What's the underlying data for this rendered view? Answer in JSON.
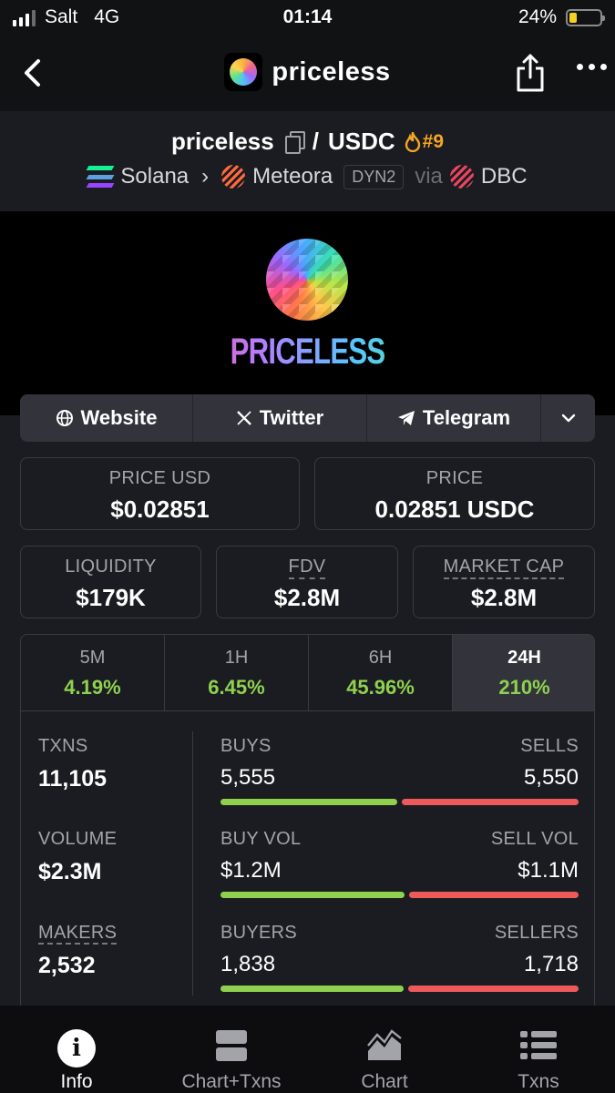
{
  "status_bar": {
    "carrier": "Salt",
    "network": "4G",
    "time": "01:14",
    "battery": "24%",
    "battery_level": 0.24
  },
  "nav": {
    "title": "priceless"
  },
  "pair": {
    "base": "priceless",
    "separator": "/",
    "quote": "USDC",
    "rank": "#9",
    "chain": "Solana",
    "dex": "Meteora",
    "pool_type": "DYN2",
    "via": "via",
    "launchpad": "DBC"
  },
  "banner": {
    "wordmark": "PRICELESS"
  },
  "links": {
    "website": "Website",
    "twitter": "Twitter",
    "telegram": "Telegram"
  },
  "price_usd": {
    "label": "PRICE USD",
    "value": "$0.02851"
  },
  "price": {
    "label": "PRICE",
    "value": "0.02851 USDC"
  },
  "liquidity": {
    "label": "LIQUIDITY",
    "value": "$179K"
  },
  "fdv": {
    "label": "FDV",
    "value": "$2.8M"
  },
  "market_cap": {
    "label": "MARKET CAP",
    "value": "$2.8M"
  },
  "timeframes": [
    {
      "name": "5M",
      "change": "4.19%"
    },
    {
      "name": "1H",
      "change": "6.45%"
    },
    {
      "name": "6H",
      "change": "45.96%"
    },
    {
      "name": "24H",
      "change": "210%"
    }
  ],
  "stats": {
    "txns": {
      "label": "TXNS",
      "value": "11,105"
    },
    "volume": {
      "label": "VOLUME",
      "value": "$2.3M"
    },
    "makers": {
      "label": "MAKERS",
      "value": "2,532"
    },
    "buys": {
      "label": "BUYS",
      "value": "5,555",
      "ratio": 0.5002
    },
    "sells": {
      "label": "SELLS",
      "value": "5,550"
    },
    "buy_vol": {
      "label": "BUY VOL",
      "value": "$1.2M",
      "ratio": 0.5217
    },
    "sell_vol": {
      "label": "SELL VOL",
      "value": "$1.1M"
    },
    "buyers": {
      "label": "BUYERS",
      "value": "1,838",
      "ratio": 0.5169
    },
    "sellers": {
      "label": "SELLERS",
      "value": "1,718"
    }
  },
  "colors": {
    "positive": "#8fd14f",
    "negative": "#ee5a5a",
    "rank": "#f5a623"
  },
  "bottom_tabs": [
    {
      "label": "Info",
      "icon": "info-icon"
    },
    {
      "label": "Chart+Txns",
      "icon": "layout-split-icon"
    },
    {
      "label": "Chart",
      "icon": "area-chart-icon"
    },
    {
      "label": "Txns",
      "icon": "list-icon"
    }
  ]
}
